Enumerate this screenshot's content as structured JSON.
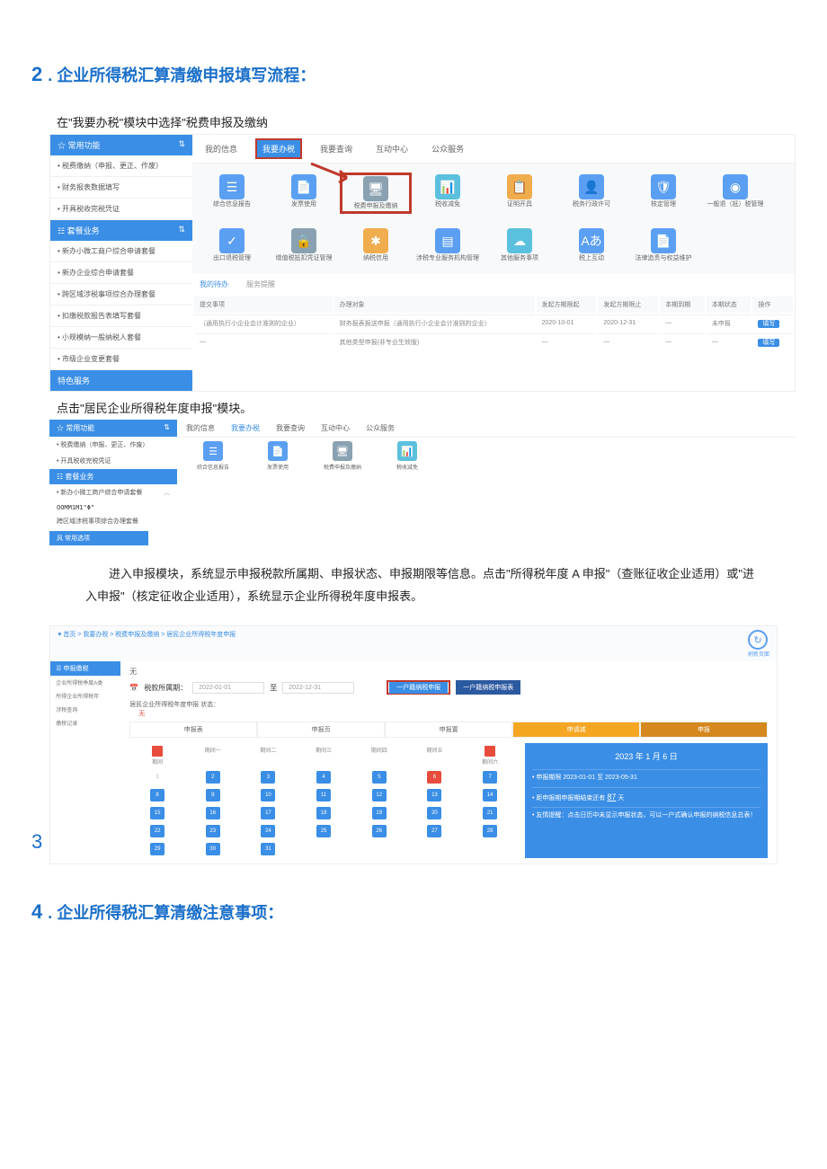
{
  "headings": {
    "h2_num": "2",
    "h2": ". 企业所得税汇算清缴申报填写流程：",
    "h4_num": "4",
    "h4": ". 企业所得税汇算清缴注意事项："
  },
  "instr1": "在\"我要办税\"模块中选择\"税费申报及缴纳",
  "instr2": "点击\"居民企业所得税年度申报\"模块。",
  "para": "进入申报模块，系统显示申报税款所属期、申报状态、申报期限等信息。点击\"所得税年度 A 申报\"（查账征收企业适用）或\"进入申报\"（核定征收企业适用），系统显示企业所得税年度申报表。",
  "s1": {
    "side_head": "常用功能",
    "side_head_icon": "☆",
    "side_items": [
      "• 税费缴纳（申报、更正、作废）",
      "• 财务报表数据填写",
      "• 开具税收完税凭证"
    ],
    "side_title1": "套餐业务",
    "side_items2": [
      "• 新办小微工商户综合申请套餐",
      "• 新办企业综合申请套餐",
      "• 跨区域涉税事项综合办理套餐",
      "• 扣缴税款报告表填写套餐",
      "• 小规模纳一般纳税人套餐",
      "• 市级企业变更套餐"
    ],
    "side_title2": "特色服务",
    "tabs": [
      "我的信息",
      "我要办税",
      "我要查询",
      "互动中心",
      "公众服务"
    ],
    "icons_r1": [
      {
        "label": "综合信息报告",
        "color": "blue",
        "g": "☰"
      },
      {
        "label": "发票使用",
        "color": "blue",
        "g": "📄"
      },
      {
        "label": "税费申报及缴纳",
        "color": "gray",
        "g": "🖥",
        "hl": true
      },
      {
        "label": "税收减免",
        "color": "teal",
        "g": "📊"
      },
      {
        "label": "证明开具",
        "color": "orange",
        "g": "📋"
      },
      {
        "label": "税务行政许可",
        "color": "blue",
        "g": "👤"
      },
      {
        "label": "核定管理",
        "color": "blue",
        "g": "🛡"
      },
      {
        "label": "一般退（抵）税管理",
        "color": "blue",
        "g": "◉"
      }
    ],
    "icons_r2": [
      {
        "label": "出口退税管理",
        "color": "blue",
        "g": "✓"
      },
      {
        "label": "增值税抵扣凭证管理",
        "color": "gray",
        "g": "🔒"
      },
      {
        "label": "纳税信用",
        "color": "orange",
        "g": "✱"
      },
      {
        "label": "涉税专业服务机构管理",
        "color": "blue",
        "g": "▤"
      },
      {
        "label": "其他服务事项",
        "color": "teal",
        "g": "☁"
      },
      {
        "label": "税上互动",
        "color": "blue",
        "g": "Aあ"
      },
      {
        "label": "法律追责与权益维护",
        "color": "blue",
        "g": "📄"
      }
    ],
    "subtabs": [
      "我的待办",
      "服务提醒"
    ],
    "th": [
      "提交事项",
      "办理对象",
      "发起方期限起",
      "发起方期限止",
      "本期到期",
      "本期状态",
      "操作"
    ],
    "rows": [
      [
        "（通用执行小企业会计准则的企业）",
        "财务报表报送申报（通用执行小企业会计准则的企业）",
        "2020-10-01",
        "2020-12-31",
        "—",
        "未申报",
        "填写"
      ],
      [
        "—",
        "其他类型申报(非专业生效版)",
        "—",
        "—",
        "—",
        "—",
        "填写"
      ]
    ]
  },
  "s2": {
    "side_head": "常用功能",
    "side_items": [
      "• 税费缴纳（申报、更正、作废）",
      "• 开具税收完税凭证"
    ],
    "side_title1": "套餐业务",
    "side_item2": "• 新办小微工商户综合申请套餐",
    "oomm": "OOMM1M1\"Φ\"",
    "footer": "跨区域涉税事项综合办理套餐",
    "footer_bar": "风 常用选项",
    "tabs": [
      "我的信息",
      "我要办税",
      "我要查询",
      "互动中心",
      "公众服务"
    ],
    "icons": [
      {
        "label": "综合信息报告",
        "color": "blue",
        "g": "☰"
      },
      {
        "label": "发票使用",
        "color": "blue",
        "g": "📄"
      },
      {
        "label": "税费申报及缴纳",
        "color": "gray",
        "g": "🖥"
      },
      {
        "label": "税收减免",
        "color": "teal",
        "g": "📊"
      }
    ]
  },
  "s3": {
    "num": "3",
    "crumb": "♥ 首页 > 我要办税 > 税费申报及缴纳 > 居民企业所得税年度申报",
    "refresh": "刷新页面",
    "side_head": "申报缴税",
    "side_items": [
      "企业所得税季度A类",
      "所得企业所得税年",
      "涉税查询",
      "缴税记录"
    ],
    "label_period": "税款所属期：",
    "date_from": "2022-01-01",
    "date_sep": "至",
    "date_to": "2022-12-31",
    "btn1": "一户籍纳税申报",
    "btn2": "一户籍纳税申报表",
    "status_label": "居民企业所得税年度申报 状态：",
    "status_val": "无",
    "steps": [
      "申报表",
      "申报页",
      "申报置",
      "申请减",
      "申报"
    ],
    "days": [
      "期间",
      "期间一",
      "期间二",
      "期间三",
      "期间四",
      "期间五",
      "期间六"
    ],
    "panel_date": "2023 年 1 月 6 日",
    "panel_row1_a": "• 申报期限 2023-01-01 至 2023-05-31",
    "panel_row2_a": "• 距申报期申报期结束还有",
    "panel_row2_b": "87",
    "panel_row2_c": "天",
    "panel_row3": "• 友情提醒：点击日历中未显示申报状态，可以一户式确认申报的纳税信息总表！"
  }
}
